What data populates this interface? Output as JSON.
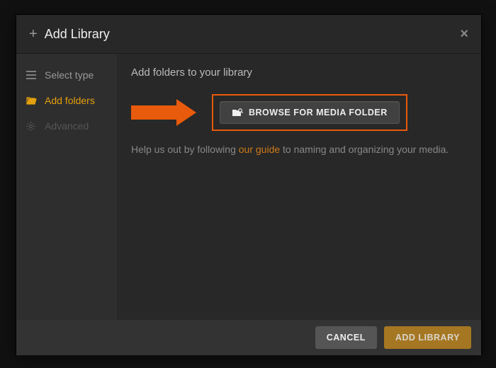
{
  "header": {
    "title": "Add Library"
  },
  "sidebar": {
    "items": [
      {
        "label": "Select type"
      },
      {
        "label": "Add folders"
      },
      {
        "label": "Advanced"
      }
    ]
  },
  "content": {
    "heading": "Add folders to your library",
    "browse_label": "BROWSE FOR MEDIA FOLDER",
    "hint_pre": "Help us out by following ",
    "hint_link": "our guide",
    "hint_post": " to naming and organizing your media."
  },
  "footer": {
    "cancel": "CANCEL",
    "add": "ADD LIBRARY"
  }
}
